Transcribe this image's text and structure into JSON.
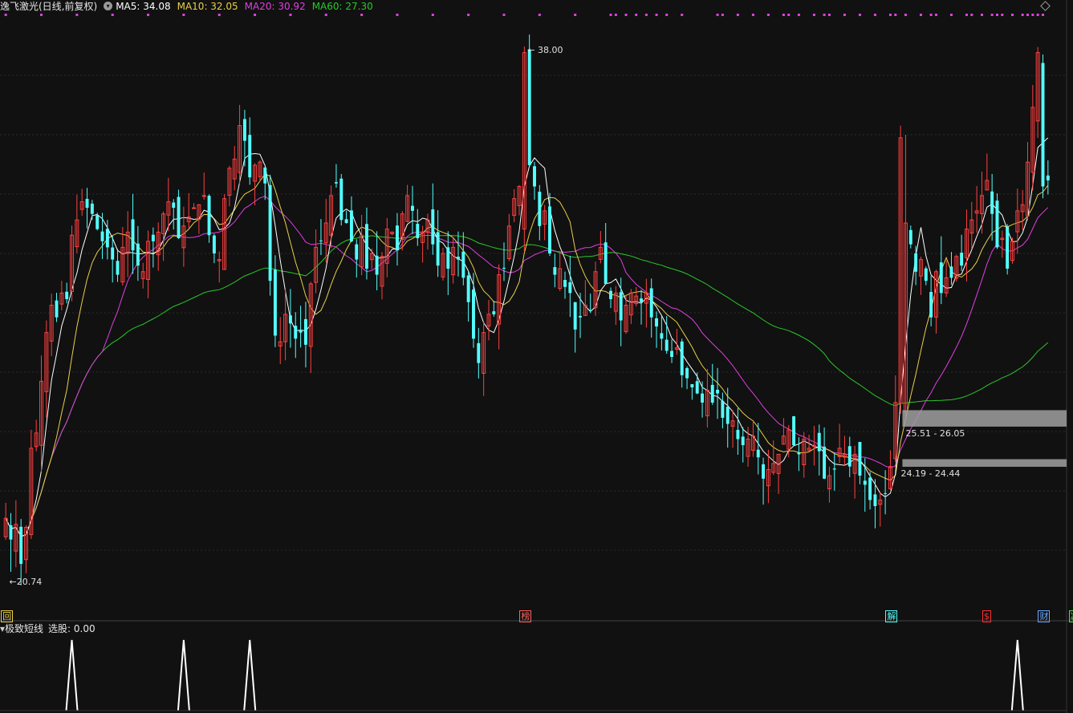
{
  "header": {
    "stock_title": "逸飞激光(日线,前复权)",
    "ma5": "MA5: 34.08",
    "ma10": "MA10: 32.05",
    "ma20": "MA20: 30.92",
    "ma60": "MA60: 27.30"
  },
  "colors": {
    "background": "#111111",
    "up_candle": "#ff4040",
    "down_candle": "#54ffff",
    "ma5": "#ffffff",
    "ma10": "#e8d048",
    "ma20": "#e040e0",
    "ma60": "#28c828",
    "marker_dots": "#e040e0"
  },
  "indicator": {
    "title": "极致短线",
    "value": "选股: 0.00"
  },
  "events": [
    {
      "label": "回",
      "color": "#e8d048",
      "bar": 0
    },
    {
      "label": "榜",
      "color": "#ff6060",
      "bar": 102
    },
    {
      "label": "解",
      "color": "#54ffff",
      "bar": 174
    },
    {
      "label": "$",
      "color": "#ff3030",
      "bar": 193
    },
    {
      "label": "财",
      "color": "#6aa8ff",
      "bar": 204
    },
    {
      "label": "减",
      "color": "#50e050",
      "bar": 210
    }
  ],
  "chart_data": {
    "type": "candlestick",
    "title": "逸飞激光(日线,前复权)",
    "price_range": [
      19.5,
      39.0
    ],
    "annotations": {
      "high": "38.00",
      "low": "20.74",
      "zone_upper": "25.51 - 26.05",
      "zone_lower": "24.19 - 24.44"
    },
    "zones": [
      [
        25.51,
        26.05
      ],
      [
        24.19,
        24.44
      ]
    ],
    "close_series": [
      22.5,
      21.8,
      22.3,
      21.0,
      22.2,
      24.8,
      25.3,
      27.0,
      28.6,
      29.5,
      29.1,
      29.9,
      29.7,
      31.8,
      32.3,
      32.9,
      32.7,
      32.5,
      32.0,
      31.6,
      31.4,
      31.0,
      30.5,
      31.4,
      31.9,
      31.3,
      30.8,
      30.6,
      31.6,
      31.6,
      31.9,
      32.5,
      32.9,
      32.7,
      31.7,
      32.1,
      32.4,
      32.7,
      32.8,
      33.1,
      31.8,
      31.2,
      31.0,
      33.0,
      34.0,
      34.3,
      35.4,
      34.9,
      33.7,
      34.1,
      34.2,
      33.5,
      30.3,
      28.5,
      28.3,
      29.2,
      28.9,
      28.4,
      28.6,
      28.2,
      30.2,
      31.4,
      31.6,
      32.2,
      33.1,
      33.5,
      32.3,
      32.2,
      31.6,
      31.0,
      31.8,
      30.7,
      31.2,
      30.5,
      31.1,
      32.0,
      31.9,
      31.3,
      32.5,
      33.1,
      32.6,
      31.7,
      31.9,
      32.3,
      31.5,
      30.8,
      31.2,
      30.7,
      31.4,
      31.0,
      30.4,
      29.6,
      28.4,
      27.6,
      28.6,
      29.2,
      29.2,
      30.5,
      30.7,
      32.1,
      33.0,
      33.4,
      37.8,
      34.1,
      33.4,
      32.1,
      32.6,
      31.2,
      30.5,
      30.7,
      30.1,
      29.9,
      28.7,
      29.1,
      29.5,
      29.3,
      30.6,
      31.4,
      30.2,
      29.7,
      29.9,
      29.0,
      29.5,
      29.9,
      29.8,
      29.6,
      29.9,
      29.1,
      28.8,
      28.4,
      28.0,
      27.8,
      28.1,
      27.2,
      27.1,
      26.8,
      26.6,
      26.3,
      26.7,
      26.3,
      26.6,
      25.8,
      25.6,
      25.7,
      25.1,
      24.9,
      25.1,
      25.2,
      24.5,
      23.8,
      24.1,
      24.3,
      24.6,
      25.2,
      25.4,
      24.9,
      24.6,
      25.1,
      24.8,
      24.9,
      24.7,
      23.8,
      23.9,
      24.1,
      24.8,
      24.6,
      24.2,
      24.6,
      23.9,
      23.6,
      23.1,
      22.9,
      23.1,
      23.3,
      24.2,
      26.3,
      35.0,
      32.2,
      31.5,
      30.6,
      31.0,
      30.3,
      29.1,
      30.6,
      29.9,
      30.4,
      30.4,
      31.1,
      30.8,
      32.0,
      32.3,
      32.6,
      33.1,
      33.6,
      32.5,
      31.4,
      31.7,
      30.7,
      31.6,
      32.6,
      32.8,
      34.2,
      36.0,
      37.8,
      33.4,
      33.6
    ]
  },
  "indicator_spikes": {
    "bars": [
      13,
      35,
      48,
      199
    ],
    "values": [
      1,
      1,
      1,
      1
    ]
  }
}
